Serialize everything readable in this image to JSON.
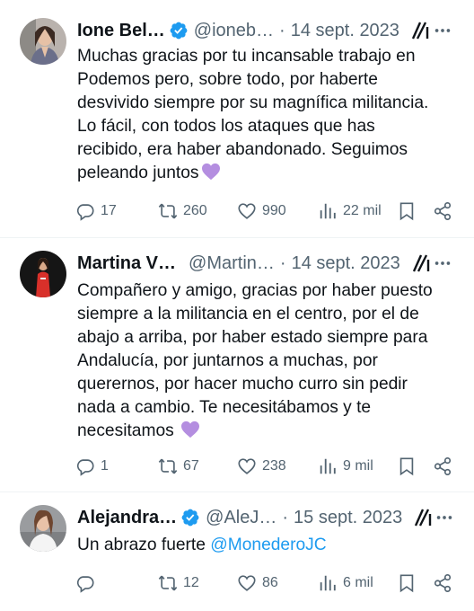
{
  "tweets": [
    {
      "name": "Ione Bel…",
      "verified": true,
      "handle": "@ioneb…",
      "separator": "·",
      "time": "14 sept. 2023",
      "lines": [
        "Muchas gracias por tu incansable trabajo en",
        "Podemos pero, sobre todo, por haberte",
        "desvivido siempre por su magnífica militancia.",
        "Lo fácil, con todos los ataques que has",
        "recibido, era haber abandonado. Seguimos",
        "peleando juntos"
      ],
      "replies": "17",
      "retweets": "260",
      "likes": "990",
      "views": "22 mil"
    },
    {
      "name": "Martina V…",
      "verified": false,
      "handle": "@Martin…",
      "separator": "·",
      "time": "14 sept. 2023",
      "lines": [
        "Compañero y amigo, gracias por haber puesto",
        "siempre a la militancia en el centro, por el de",
        "abajo a arriba, por haber estado siempre para",
        "Andalucía, por juntarnos a muchas, por",
        "querernos, por hacer mucho curro sin pedir",
        "nada a cambio. Te necesitábamos y te",
        "necesitamos"
      ],
      "replies": "1",
      "retweets": "67",
      "likes": "238",
      "views": "9 mil"
    },
    {
      "name": "Alejandra…",
      "verified": true,
      "handle": "@AleJ…",
      "separator": "·",
      "time": "15 sept. 2023",
      "text_prefix": "Un abrazo fuerte ",
      "mention": "@MonederoJC",
      "replies": "",
      "retweets": "12",
      "likes": "86",
      "views": "6 mil"
    }
  ],
  "colors": {
    "text": "#0f1419",
    "secondary": "#536471",
    "link": "#1d9bf0",
    "verified": "#1d9bf0",
    "heart_emoji": "#b48ee0",
    "divider": "#eff3f4"
  }
}
